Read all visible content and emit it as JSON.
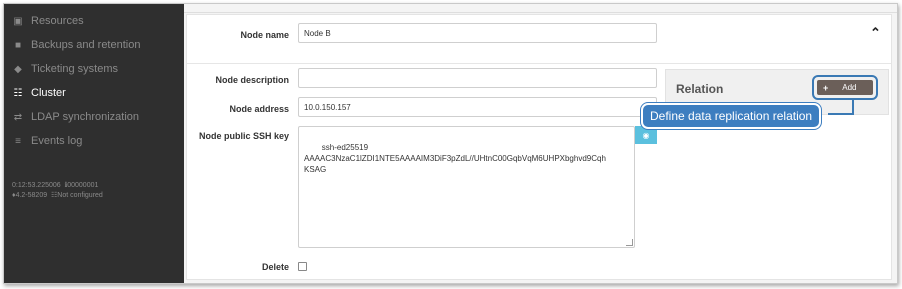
{
  "sidebar": {
    "items": [
      {
        "label": "Resources",
        "icon": "image-icon"
      },
      {
        "label": "Backups and retention",
        "icon": "archive-icon"
      },
      {
        "label": "Ticketing systems",
        "icon": "tag-icon"
      },
      {
        "label": "Cluster",
        "icon": "sitemap-icon"
      },
      {
        "label": "LDAP synchronization",
        "icon": "sync-icon"
      },
      {
        "label": "Events log",
        "icon": "list-icon"
      }
    ],
    "active": "Cluster",
    "meta": {
      "uptime": "0:12:53.225006",
      "id": "00000001",
      "version": "4.2-58209",
      "cluster_status": "Not configured"
    }
  },
  "form": {
    "node_name_label": "Node name",
    "node_name_value": "Node B",
    "node_description_label": "Node description",
    "node_description_value": "",
    "node_address_label": "Node address",
    "node_address_value": "10.0.150.157",
    "node_ssh_key_label": "Node public SSH key",
    "node_ssh_key_value": "ssh-ed25519\nAAAAC3NzaC1lZDI1NTE5AAAAIM3DiF3pZdL//UHtnC00GqbVqM6UHPXbghvd9Cqh\nKSAG",
    "delete_label": "Delete",
    "delete_checked": false
  },
  "relation": {
    "title": "Relation",
    "add_label": "Add"
  },
  "callout": {
    "text": "Define data replication relation"
  },
  "colors": {
    "sidebar_bg": "#2f2f2f",
    "accent_blue": "#3d7ec0",
    "add_button": "#6b5f59",
    "copy_button": "#5bc0de"
  }
}
